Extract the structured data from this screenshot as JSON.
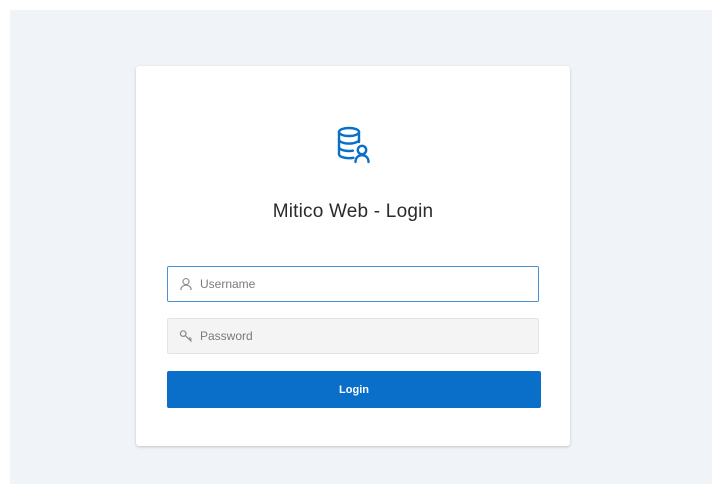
{
  "app": {
    "title": "Mitico Web - Login",
    "logo_icon": "database-user-icon",
    "accent_color": "#0a6fc8"
  },
  "form": {
    "username": {
      "placeholder": "Username",
      "value": "",
      "icon": "user-icon"
    },
    "password": {
      "placeholder": "Password",
      "value": "",
      "icon": "key-icon"
    },
    "login_label": "Login"
  }
}
